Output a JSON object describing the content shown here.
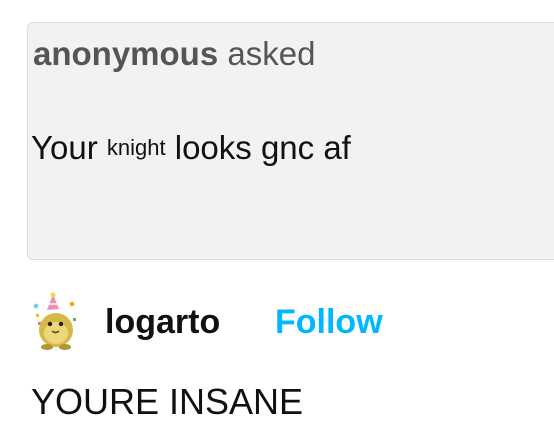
{
  "ask": {
    "asker_name": "anonymous",
    "asked_label": "asked",
    "question_part1": "Your",
    "question_small": "knight",
    "question_part2": "looks gnc af"
  },
  "answer": {
    "avatar_icon": "party-hat-creature-avatar-icon",
    "username": "logarto",
    "follow_label": "Follow",
    "reply_text": "YOURE INSANE"
  },
  "colors": {
    "ask_background": "#f2f2f2",
    "follow_link": "#00b8ff"
  }
}
